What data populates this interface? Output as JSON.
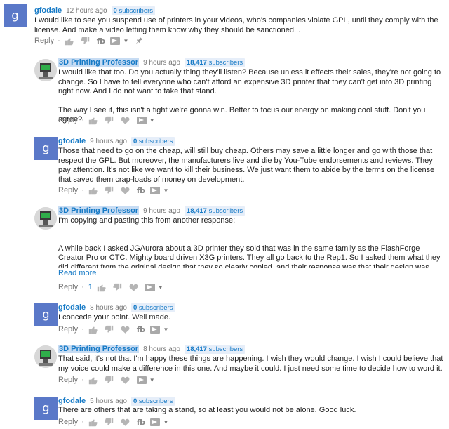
{
  "reply_label": "Reply",
  "read_more_label": "Read more",
  "comments": [
    {
      "author": "gfodale",
      "time": "12 hours ago",
      "subs_count": "0",
      "subs_label": "subscribers",
      "avatar_letter": "g",
      "body": [
        "I would like to see you suspend use of printers in your videos, who's companies violate GPL, until they comply with the license. And make a video letting them know why they should be sanctioned..."
      ]
    },
    {
      "author": "3D Printing Professor",
      "time": "9 hours ago",
      "subs_count": "18,417",
      "subs_label": "subscribers",
      "body": [
        "I would like that too. Do you actually thing they'll listen? Because unless it effects their sales, they're not going to change. So I have to tell everyone who can't afford an expensive 3D printer that they can't get into 3D printing right now. And I do not want to take that stand.",
        "The way I see it, this isn't a fight we're gonna win. Better to focus our energy on making cool stuff. Don't you agree?"
      ]
    },
    {
      "author": "gfodale",
      "time": "9 hours ago",
      "subs_count": "0",
      "subs_label": "subscribers",
      "avatar_letter": "g",
      "body": [
        "Those that need to go on the cheap, will still buy cheap.  Others may save a little longer and go with those that respect the GPL. But moreover, the manufacturers live and die by You-Tube endorsements and reviews.  They pay attention.  It's not like we want to kill their business. We just want them to abide by the terms on the license that saved them crap-loads of money on development."
      ]
    },
    {
      "author": "3D Printing Professor",
      "time": "9 hours ago",
      "subs_count": "18,417",
      "subs_label": "subscribers",
      "like_count": "1",
      "body": [
        "I'm copying and pasting this from another response:",
        "A while back I asked JGAurora about a 3D printer they sold that was in the same family as the FlashForge Creator Pro or CTC. Mighty board driven X3G printers. They all go back to the Rep1. So I asked them what they did different from the original design that they so clearly copied, and their response was that their design was completely original, from scratch."
      ]
    },
    {
      "author": "gfodale",
      "time": "8 hours ago",
      "subs_count": "0",
      "subs_label": "subscribers",
      "avatar_letter": "g",
      "body": [
        "I concede your point.  Well made."
      ]
    },
    {
      "author": "3D Printing Professor",
      "time": "8 hours ago",
      "subs_count": "18,417",
      "subs_label": "subscribers",
      "body": [
        "That said, it's not that I'm happy these things are happening. I wish they would change. I wish I could believe that my voice could make a difference in this one. And maybe it could. I just need some time to decide how to word it."
      ]
    },
    {
      "author": "gfodale",
      "time": "5 hours ago",
      "subs_count": "0",
      "subs_label": "subscribers",
      "avatar_letter": "g",
      "body": [
        "There are others that are taking a stand, so at least you would not be alone.  Good luck."
      ]
    }
  ]
}
